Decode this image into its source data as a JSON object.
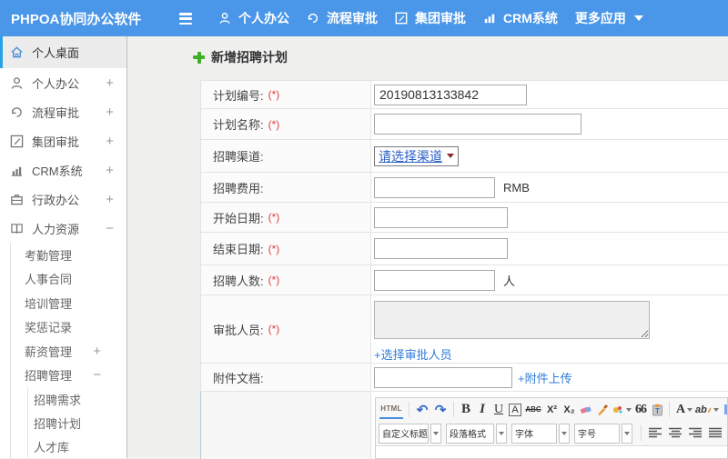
{
  "header": {
    "app_title": "PHPOA协同办公软件",
    "nav": [
      {
        "label": "个人办公"
      },
      {
        "label": "流程审批"
      },
      {
        "label": "集团审批"
      },
      {
        "label": "CRM系统"
      },
      {
        "label": "更多应用"
      }
    ]
  },
  "sidebar": {
    "items": [
      {
        "label": "个人桌面"
      },
      {
        "label": "个人办公",
        "expander": "+"
      },
      {
        "label": "流程审批",
        "expander": "+"
      },
      {
        "label": "集团审批",
        "expander": "+"
      },
      {
        "label": "CRM系统",
        "expander": "+"
      },
      {
        "label": "行政办公",
        "expander": "+"
      },
      {
        "label": "人力资源",
        "expander": "−"
      }
    ],
    "hr_children": [
      {
        "label": "考勤管理"
      },
      {
        "label": "人事合同"
      },
      {
        "label": "培训管理"
      },
      {
        "label": "奖惩记录"
      },
      {
        "label": "薪资管理",
        "expander": "+"
      },
      {
        "label": "招聘管理",
        "expander": "−"
      }
    ],
    "recruit_children": [
      {
        "label": "招聘需求"
      },
      {
        "label": "招聘计划"
      },
      {
        "label": "人才库"
      }
    ]
  },
  "main": {
    "page_title": "新增招聘计划",
    "form": {
      "labels": {
        "plan_no": "计划编号:",
        "plan_name": "计划名称:",
        "channel": "招聘渠道:",
        "fee": "招聘费用:",
        "start": "开始日期:",
        "end": "结束日期:",
        "count": "招聘人数:",
        "approver": "审批人员:",
        "attachment": "附件文档:"
      },
      "required_mark": "(*)",
      "plan_no_value": "20190813133842",
      "channel_selected": "请选择渠道",
      "fee_unit": "RMB",
      "count_unit": "人",
      "approver_link": "+选择审批人员",
      "attachment_link": "+附件上传"
    },
    "editor": {
      "html_button": "HTML",
      "undo": "↶",
      "redo": "↷",
      "bold": "B",
      "italic": "I",
      "underline": "U",
      "autotype": "A",
      "strike": "ABC",
      "sup": "X²",
      "sub": "X₂",
      "quote": "66",
      "fontcolor": "A",
      "highlight": "ab",
      "dropdowns": [
        "自定义标题",
        "段落格式",
        "字体",
        "字号"
      ]
    }
  }
}
